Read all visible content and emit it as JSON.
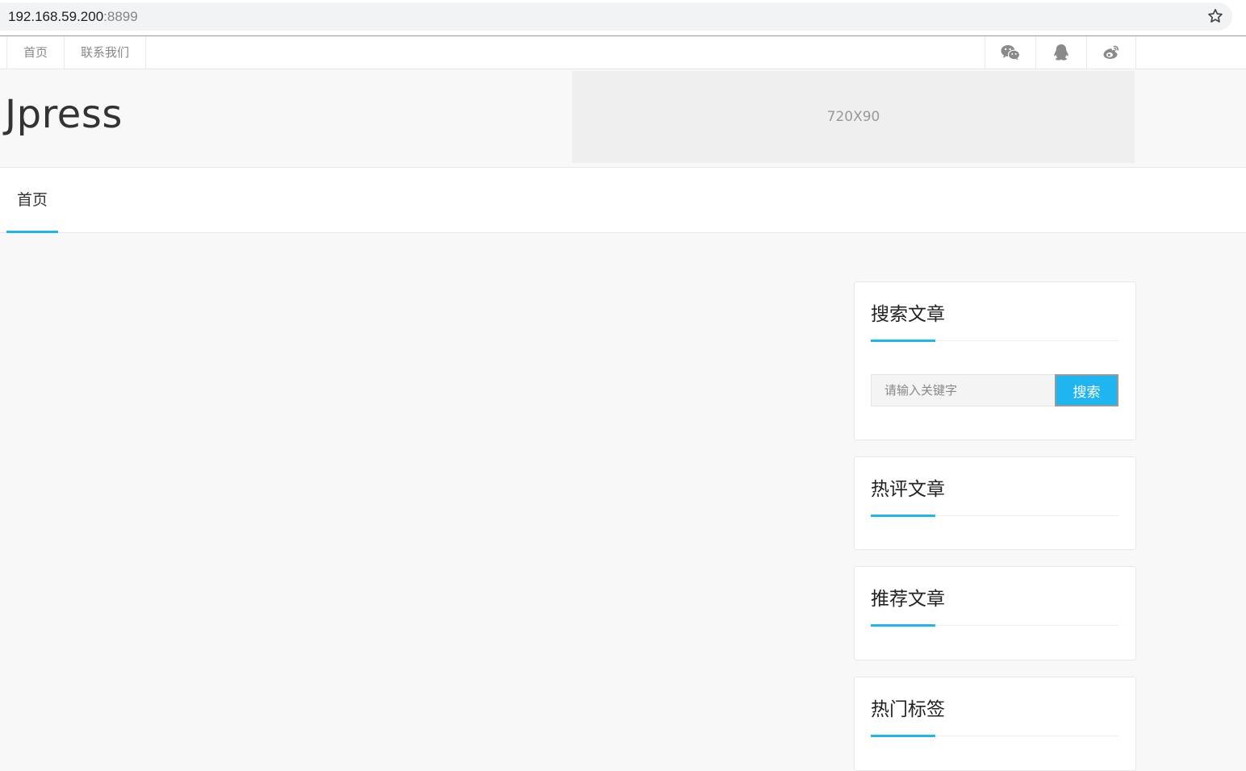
{
  "browser": {
    "url_host": "192.168.59.200",
    "url_port": ":8899",
    "bookmark_icon": "star-icon"
  },
  "topbar": {
    "links": [
      "首页",
      "联系我们"
    ],
    "social_icons": [
      "wechat-icon",
      "qq-icon",
      "weibo-icon"
    ]
  },
  "header": {
    "logo": "Jpress",
    "ad_placeholder": "720X90"
  },
  "nav": {
    "items": [
      "首页"
    ],
    "active_index": 0
  },
  "sidebar": {
    "search_widget": {
      "title": "搜索文章",
      "placeholder": "请输入关键字",
      "button_label": "搜索"
    },
    "hot_comment_widget": {
      "title": "热评文章"
    },
    "recommend_widget": {
      "title": "推荐文章"
    },
    "hot_tags_widget": {
      "title": "热门标签"
    }
  },
  "colors": {
    "accent": "#1fb5f0",
    "page_bg": "#f8f8f8",
    "ad_bg": "#efefef"
  }
}
